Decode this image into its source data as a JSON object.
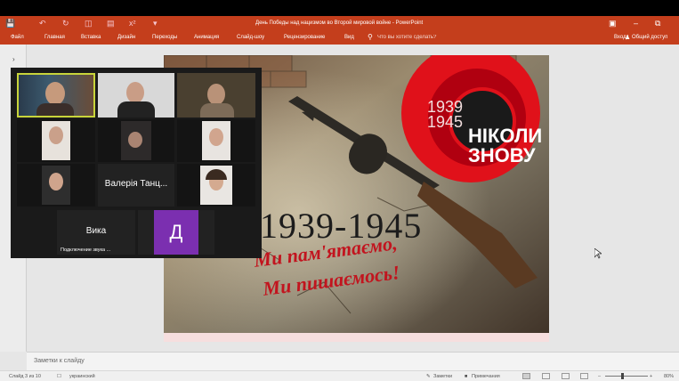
{
  "window": {
    "title": "День Победы над нацизмом во Второй мировой войне - PowerPoint",
    "login": "Вход",
    "share": "Общий доступ"
  },
  "ribbon": {
    "tabs": [
      "Файл",
      "Главная",
      "Вставка",
      "Дизайн",
      "Переходы",
      "Анимация",
      "Слайд-шоу",
      "Рецензирование",
      "Вид"
    ],
    "tell_me": "Что вы хотите сделать?"
  },
  "slide": {
    "years_badge": "1939\n1945",
    "never_line1": "НІКОЛИ",
    "never_line2": "ЗНОВУ",
    "main_years": "1939-1945",
    "slogan_line1": "Ми пам'ятаємо,",
    "slogan_line2": "Ми пишаємось!"
  },
  "notes": {
    "placeholder": "Заметки к слайду"
  },
  "status": {
    "slide_counter": "Слайд 3 из 10",
    "language": "украинский",
    "notes_btn": "Заметки",
    "comments_btn": "Примечания",
    "zoom": "80%"
  },
  "zoom_call": {
    "participants": [
      {
        "name": "",
        "type": "video"
      },
      {
        "name": "",
        "type": "video"
      },
      {
        "name": "",
        "type": "video"
      },
      {
        "name": "",
        "type": "video"
      },
      {
        "name": "",
        "type": "video"
      },
      {
        "name": "",
        "type": "video"
      },
      {
        "name": "",
        "type": "video"
      },
      {
        "name": "Валерія Танц...",
        "type": "name"
      },
      {
        "name": "",
        "type": "video"
      },
      {
        "name": "Вика",
        "type": "name",
        "sub": "Подключение звука ..."
      },
      {
        "name": "Д",
        "type": "avatar"
      }
    ]
  },
  "colors": {
    "ppt_accent": "#c43e1c",
    "poppy_red": "#e0111a",
    "avatar_purple": "#7b2fb0",
    "active_speaker": "#c8d43a"
  }
}
